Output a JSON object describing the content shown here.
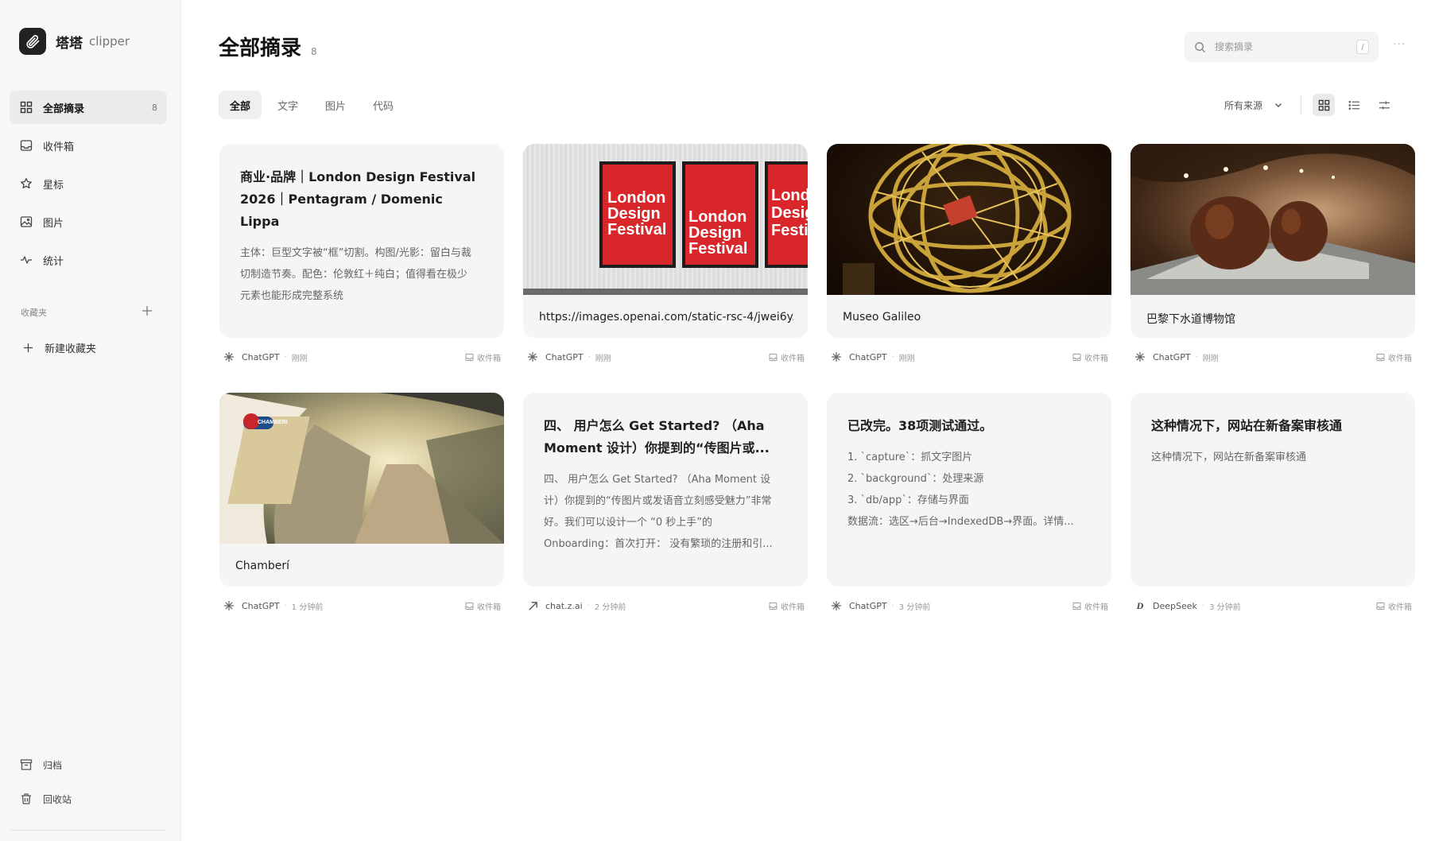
{
  "app": {
    "name": "塔塔",
    "sub": "clipper"
  },
  "sidebar": {
    "items": [
      {
        "label": "全部摘录",
        "count": "8",
        "icon": "grid-icon"
      },
      {
        "label": "收件箱",
        "icon": "inbox-icon"
      },
      {
        "label": "星标",
        "icon": "star-icon"
      },
      {
        "label": "图片",
        "icon": "image-icon"
      },
      {
        "label": "统计",
        "icon": "pulse-icon"
      }
    ],
    "folders_title": "收藏夹",
    "new_folder": "新建收藏夹",
    "bottom": [
      {
        "label": "归档",
        "icon": "archive-icon"
      },
      {
        "label": "回收站",
        "icon": "trash-icon"
      }
    ]
  },
  "header": {
    "title": "全部摘录",
    "count": "8",
    "search_placeholder": "搜索摘录",
    "search_shortcut": "/",
    "more": "···"
  },
  "tabs": [
    "全部",
    "文字",
    "图片",
    "代码"
  ],
  "filter": {
    "source": "所有来源"
  },
  "cards": [
    {
      "title": "商业·品牌｜London Design Festival 2026｜Pentagram / Domenic Lippa",
      "title_lines": [
        "商业·品牌｜London Design Festival",
        "2026｜Pentagram / Domenic Lippa"
      ],
      "body_lines": [
        "主体：巨型文字被“框”切割。构图/光影：留白与裁",
        "切制造节奏。配色：伦敦红＋纯白；值得看在极少",
        "元素也能形成完整系统"
      ],
      "source": "ChatGPT",
      "time": "刚刚",
      "inbox": "收件箱"
    },
    {
      "caption": "https://images.openai.com/static-rsc-4/jwei6y...",
      "poster_text": [
        "London",
        "Design",
        "Festival"
      ],
      "source": "ChatGPT",
      "time": "刚刚",
      "inbox": "收件箱"
    },
    {
      "caption": "Museo Galileo",
      "source": "ChatGPT",
      "time": "刚刚",
      "inbox": "收件箱"
    },
    {
      "caption": "巴黎下水道博物馆",
      "source": "ChatGPT",
      "time": "刚刚",
      "inbox": "收件箱"
    },
    {
      "caption": "Chamberí",
      "sign_text": "CHAMBERI",
      "source": "ChatGPT",
      "time": "1 分钟前",
      "inbox": "收件箱"
    },
    {
      "title_lines": [
        "四、 用户怎么 Get Started? （Aha",
        "Moment 设计）你提到的“传图片或..."
      ],
      "body_lines": [
        "四、 用户怎么 Get Started? （Aha Moment 设",
        "计）你提到的“传图片或发语音立刻感受魅力”非常",
        "好。我们可以设计一个 “0 秒上手”的",
        "Onboarding：首次打开： 没有繁琐的注册和引..."
      ],
      "source": "chat.z.ai",
      "time": "2 分钟前",
      "inbox": "收件箱"
    },
    {
      "title_lines": [
        "已改完。38项测试通过。"
      ],
      "body_lines": [
        "1. `capture`：抓文字图片",
        "2. `background`：处理来源",
        "3. `db/app`：存储与界面",
        "数据流：选区→后台→IndexedDB→界面。详情..."
      ],
      "source": "ChatGPT",
      "time": "3 分钟前",
      "inbox": "收件箱"
    },
    {
      "title_lines": [
        "这种情况下，网站在新备案审核通"
      ],
      "body_lines": [
        "这种情况下，网站在新备案审核通"
      ],
      "source": "DeepSeek",
      "time": "3 分钟前",
      "inbox": "收件箱"
    }
  ],
  "colors": {
    "accent_red": "#d8262a",
    "brand_dark": "#222222"
  }
}
